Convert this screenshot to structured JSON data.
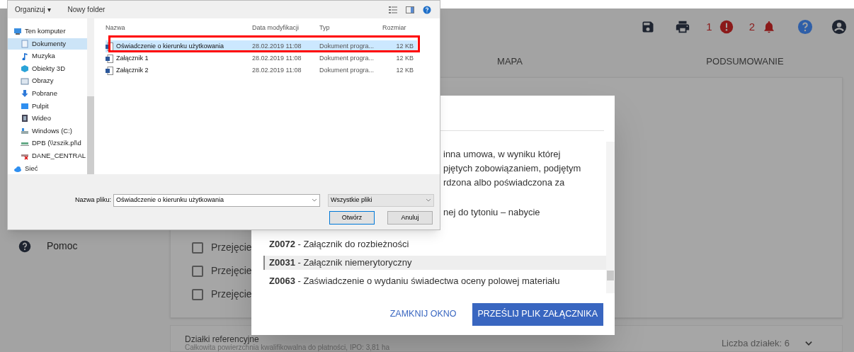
{
  "app": {
    "toolbar": {
      "alerts_count": "1",
      "notifications_count": "2"
    },
    "tabs": [
      {
        "label": "MAPA",
        "selected": false
      },
      {
        "label": "PODSUMOWANIE",
        "selected": false
      }
    ],
    "sidebar": {
      "items": [
        {
          "label": "Pomoc"
        }
      ]
    },
    "checkbox_rows": [
      {
        "label": "Przejęcie",
        "checked": false
      },
      {
        "label": "Przejęcie",
        "checked": false
      },
      {
        "label": "Przejęcie",
        "checked": false
      }
    ],
    "reference_parcels": {
      "title": "Działki referencyjne",
      "subtitle": "Całkowita powierzchnia kwalifikowalna do płatności, IPO: 3,81 ha",
      "count": "Liczba działek: 6"
    }
  },
  "modal": {
    "list": [
      {
        "kind": "fragment",
        "text": "inna umowa, w wyniku której"
      },
      {
        "kind": "fragment",
        "text": "pjętych zobowiązaniem, podjętym"
      },
      {
        "kind": "fragment",
        "text": "rdzona albo poświadczona za"
      },
      {
        "kind": "gap"
      },
      {
        "kind": "fragment",
        "text": "nej do tytoniu – nabycie"
      },
      {
        "kind": "gap"
      },
      {
        "kind": "option",
        "text": "**Z0072** - Załącznik do rozbieżności",
        "selected": false
      },
      {
        "kind": "option",
        "text": "**Z0031** - Załącznik niemerytoryczny",
        "selected": true
      },
      {
        "kind": "option",
        "text": "**Z0063** - Zaświadczenie o wydaniu świadectwa oceny polowej materiału",
        "selected": false
      }
    ],
    "buttons": [
      {
        "kind": "text",
        "label": "ZAMKNIJ OKNO"
      },
      {
        "kind": "primary",
        "label": "PRZEŚLIJ PLIK ZAŁĄCZNIKA"
      }
    ]
  },
  "file_dialog": {
    "toolbar": [
      "Organizuj ▾",
      "Nowy folder"
    ],
    "nav": [
      {
        "label": "Ten komputer",
        "selected": false,
        "children": [
          {
            "label": "Dokumenty",
            "selected": true
          },
          {
            "label": "Muzyka",
            "selected": false
          },
          {
            "label": "Obiekty 3D",
            "selected": false
          },
          {
            "label": "Obrazy",
            "selected": false
          },
          {
            "label": "Pobrane",
            "selected": false
          },
          {
            "label": "Pulpit",
            "selected": false
          },
          {
            "label": "Wideo",
            "selected": false
          },
          {
            "label": "Windows (C:)",
            "selected": false
          },
          {
            "label": "DPB (\\\\zszik.pl\\d",
            "selected": false
          },
          {
            "label": "DANE_CENTRAL",
            "selected": false
          }
        ]
      },
      {
        "label": "Sieć",
        "selected": false
      }
    ],
    "columns": [
      "Nazwa",
      "Data modyfikacji",
      "Typ",
      "Rozmiar"
    ],
    "rows": [
      {
        "name": "Oświadczenie o kierunku użytkowania",
        "date": "28.02.2019 11:08",
        "type": "Dokument progra...",
        "size": "12 KB",
        "selected": true
      },
      {
        "name": "Załącznik 1",
        "date": "28.02.2019 11:08",
        "type": "Dokument progra...",
        "size": "12 KB",
        "selected": false
      },
      {
        "name": "Załącznik 2",
        "date": "28.02.2019 11:08",
        "type": "Dokument progra...",
        "size": "12 KB",
        "selected": false
      }
    ],
    "filename_label": "Nazwa pliku:",
    "filename_value": "Oświadczenie o kierunku użytkowania",
    "filter": "Wszystkie pliki",
    "buttons": [
      "Otwórz",
      "Anuluj"
    ]
  }
}
